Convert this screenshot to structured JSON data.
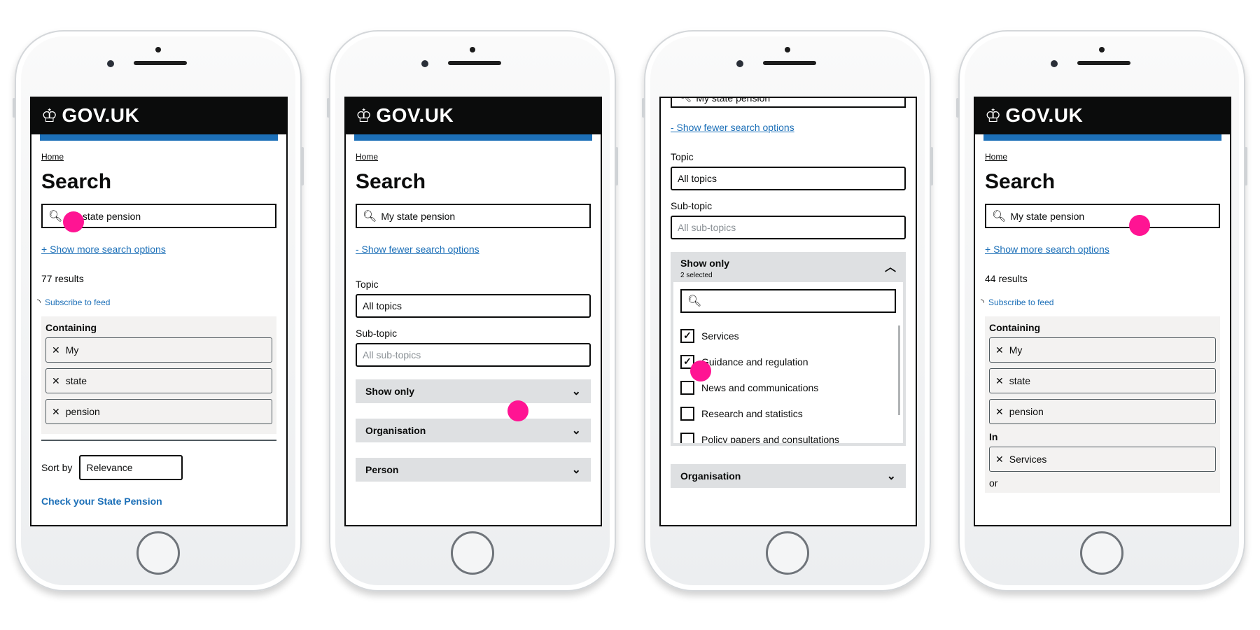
{
  "brand": "GOV.UK",
  "crown_icon": "crown-icon",
  "colors": {
    "link": "#1d70b8",
    "header": "#0b0c0c",
    "highlight": "#ff1493",
    "panel": "#dee0e2"
  },
  "screen1": {
    "breadcrumb": "Home",
    "title": "Search",
    "query": "My state pension",
    "more_options": "+ Show more search options",
    "results_count": "77 results",
    "subscribe": "Subscribe to feed",
    "facet_label": "Containing",
    "tags": [
      "My",
      "state",
      "pension"
    ],
    "sort_label": "Sort by",
    "sort_value": "Relevance",
    "first_result": "Check your State Pension"
  },
  "screen2": {
    "breadcrumb": "Home",
    "title": "Search",
    "query": "My state pension",
    "fewer_options": "- Show fewer search options",
    "topic_label": "Topic",
    "topic_value": "All topics",
    "subtopic_label": "Sub-topic",
    "subtopic_placeholder": "All sub-topics",
    "accordions": [
      "Show only",
      "Organisation",
      "Person"
    ]
  },
  "screen3": {
    "query_partial": "My state pension",
    "fewer_options": "- Show fewer search options",
    "topic_label": "Topic",
    "topic_value": "All topics",
    "subtopic_label": "Sub-topic",
    "subtopic_placeholder": "All sub-topics",
    "show_only_title": "Show only",
    "show_only_selected": "2 selected",
    "options": [
      {
        "label": "Services",
        "checked": true
      },
      {
        "label": "Guidance and regulation",
        "checked": true
      },
      {
        "label": "News and communications",
        "checked": false
      },
      {
        "label": "Research and statistics",
        "checked": false
      },
      {
        "label": "Policy papers and consultations",
        "checked": false
      }
    ],
    "organisation": "Organisation"
  },
  "screen4": {
    "breadcrumb": "Home",
    "title": "Search",
    "query": "My state pension",
    "more_options": "+ Show more search options",
    "results_count": "44 results",
    "subscribe": "Subscribe to feed",
    "facet_label": "Containing",
    "tags": [
      "My",
      "state",
      "pension"
    ],
    "in_label": "In",
    "in_tags": [
      "Services"
    ],
    "or_label": "or"
  }
}
